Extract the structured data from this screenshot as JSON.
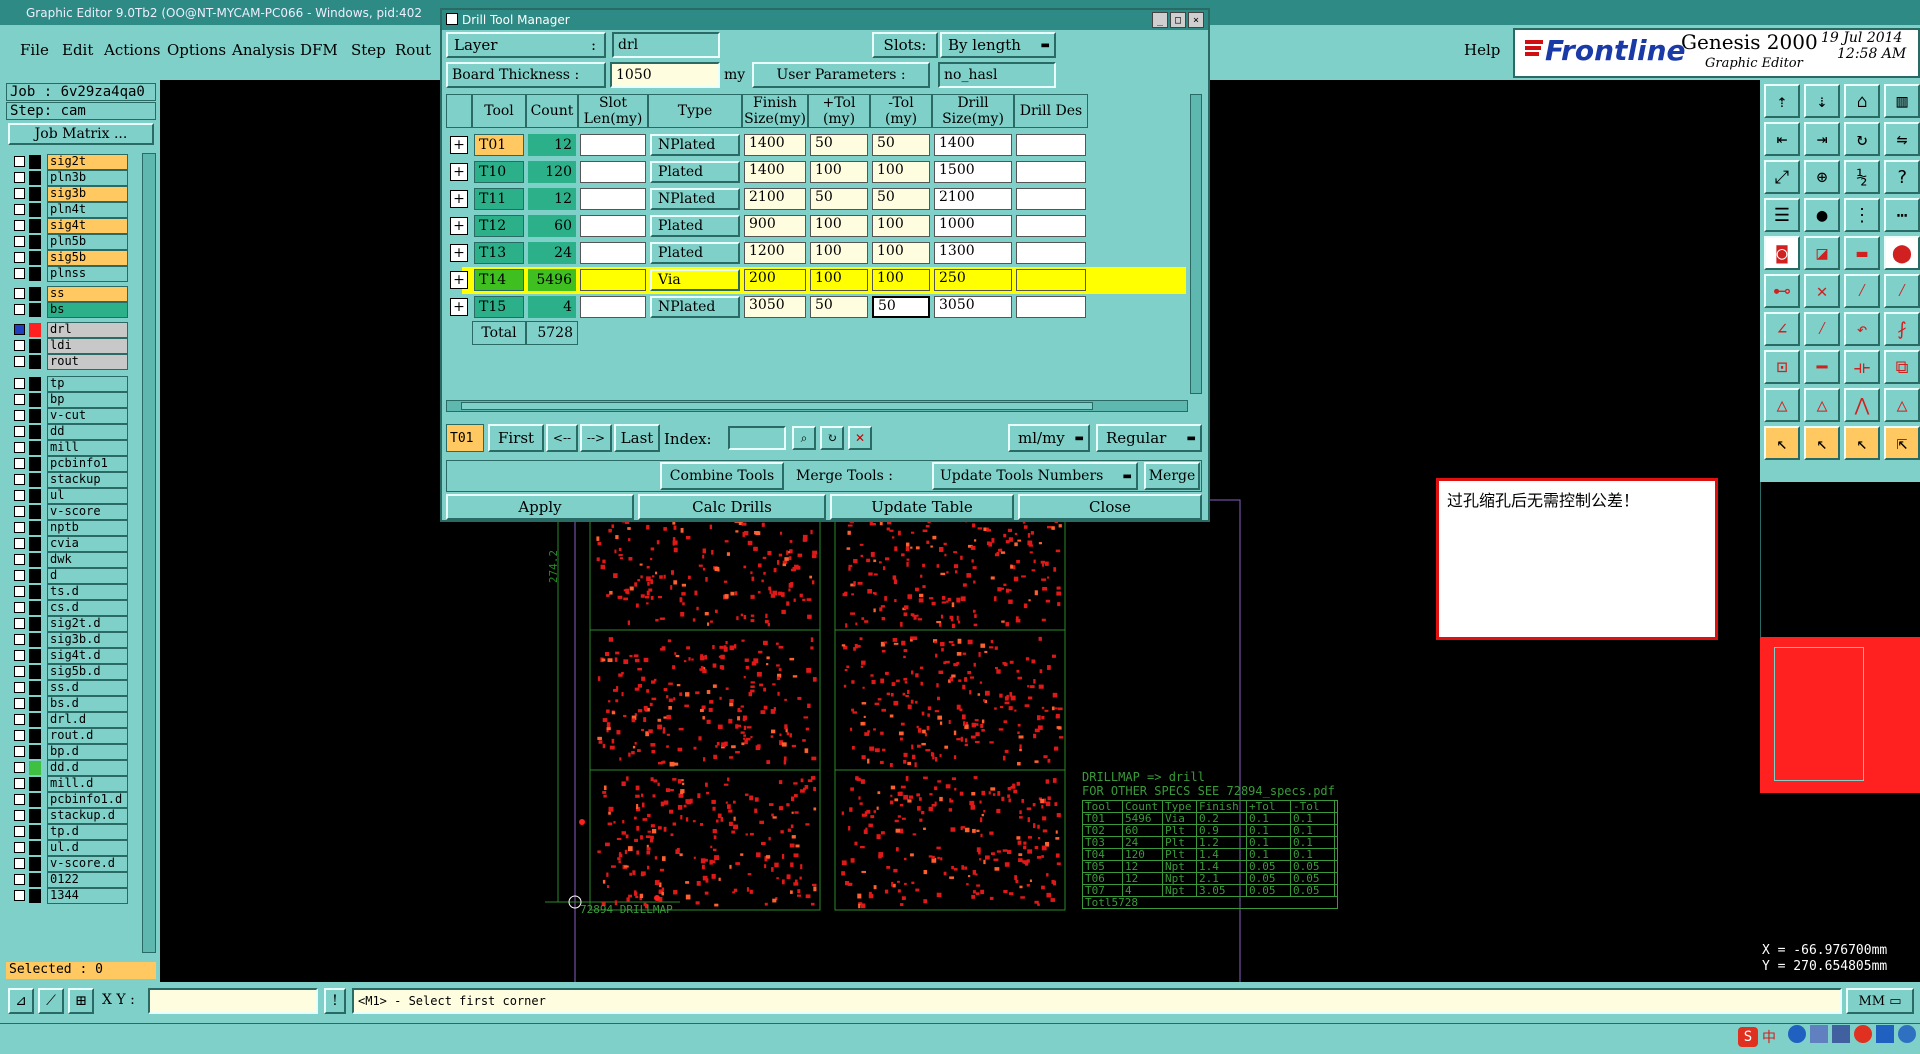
{
  "app": {
    "window_title": "Graphic Editor 9.0Tb2 (OO@NT-MYCAM-PC066 - Windows, pid:402",
    "menu": [
      "File",
      "Edit",
      "Actions",
      "Options",
      "Analysis",
      "DFM",
      "Step",
      "Rout"
    ],
    "help": "Help",
    "brand": "Frontline",
    "product": "Genesis 2000",
    "subtitle": "Graphic Editor",
    "date": "19 Jul 2014",
    "time": "12:58 AM"
  },
  "left": {
    "job": "Job : 6v29za4qa0",
    "step": "Step: cam",
    "job_matrix": "Job Matrix ...",
    "layers": [
      {
        "name": "sig2t",
        "color": "#ffc860"
      },
      {
        "name": "pln3b",
        "color": "#7ed0c8"
      },
      {
        "name": "sig3b",
        "color": "#ffc860"
      },
      {
        "name": "pln4t",
        "color": "#7ed0c8"
      },
      {
        "name": "sig4t",
        "color": "#ffc860"
      },
      {
        "name": "pln5b",
        "color": "#7ed0c8"
      },
      {
        "name": "sig5b",
        "color": "#ffc860"
      },
      {
        "name": "plnss",
        "color": "#7ed0c8"
      },
      {
        "name": "ss",
        "color": "#ffc860"
      },
      {
        "name": "bs",
        "color": "#2cb08a"
      },
      {
        "name": "drl",
        "color": "#c8c8c8"
      },
      {
        "name": "ldi",
        "color": "#c8c8c8"
      },
      {
        "name": "rout",
        "color": "#c8c8c8"
      },
      {
        "name": "tp",
        "color": "#7ed0c8"
      },
      {
        "name": "bp",
        "color": "#7ed0c8"
      },
      {
        "name": "v-cut",
        "color": "#7ed0c8"
      },
      {
        "name": "dd",
        "color": "#7ed0c8"
      },
      {
        "name": "mill",
        "color": "#7ed0c8"
      },
      {
        "name": "pcbinfo1",
        "color": "#7ed0c8"
      },
      {
        "name": "stackup",
        "color": "#7ed0c8"
      },
      {
        "name": "ul",
        "color": "#7ed0c8"
      },
      {
        "name": "v-score",
        "color": "#7ed0c8"
      },
      {
        "name": "nptb",
        "color": "#7ed0c8"
      },
      {
        "name": "cvia",
        "color": "#7ed0c8"
      },
      {
        "name": "dwk",
        "color": "#7ed0c8"
      },
      {
        "name": "d",
        "color": "#7ed0c8"
      },
      {
        "name": "ts.d",
        "color": "#7ed0c8"
      },
      {
        "name": "cs.d",
        "color": "#7ed0c8"
      },
      {
        "name": "sig2t.d",
        "color": "#7ed0c8"
      },
      {
        "name": "sig3b.d",
        "color": "#7ed0c8"
      },
      {
        "name": "sig4t.d",
        "color": "#7ed0c8"
      },
      {
        "name": "sig5b.d",
        "color": "#7ed0c8"
      },
      {
        "name": "ss.d",
        "color": "#7ed0c8"
      },
      {
        "name": "bs.d",
        "color": "#7ed0c8"
      },
      {
        "name": "drl.d",
        "color": "#7ed0c8"
      },
      {
        "name": "rout.d",
        "color": "#7ed0c8"
      },
      {
        "name": "bp.d",
        "color": "#7ed0c8"
      },
      {
        "name": "dd.d",
        "color": "#7ed0c8"
      },
      {
        "name": "mill.d",
        "color": "#7ed0c8"
      },
      {
        "name": "pcbinfo1.d",
        "color": "#7ed0c8"
      },
      {
        "name": "stackup.d",
        "color": "#7ed0c8"
      },
      {
        "name": "tp.d",
        "color": "#7ed0c8"
      },
      {
        "name": "ul.d",
        "color": "#7ed0c8"
      },
      {
        "name": "v-score.d",
        "color": "#7ed0c8"
      },
      {
        "name": "0122",
        "color": "#7ed0c8"
      },
      {
        "name": "1344",
        "color": "#7ed0c8"
      }
    ],
    "selected": "Selected : 0"
  },
  "dialog": {
    "title": "Drill Tool Manager",
    "layer_label": "Layer",
    "layer_value": "drl",
    "slots_label": "Slots:",
    "slots_value": "By length",
    "thickness_label": "Board Thickness :",
    "thickness_value": "1050",
    "thickness_unit": "my",
    "user_params_label": "User Parameters :",
    "user_params_value": "no_hasl",
    "columns": [
      "Tool",
      "Count",
      "Slot Len(my)",
      "Type",
      "Finish Size(my)",
      "+Tol (my)",
      "-Tol (my)",
      "Drill Size(my)",
      "Drill Des"
    ],
    "rows": [
      {
        "tool": "T01",
        "count": "12",
        "type": "NPlated",
        "finish": "1400",
        "ptol": "50",
        "mtol": "50",
        "drill": "1400"
      },
      {
        "tool": "T10",
        "count": "120",
        "type": "Plated",
        "finish": "1400",
        "ptol": "100",
        "mtol": "100",
        "drill": "1500"
      },
      {
        "tool": "T11",
        "count": "12",
        "type": "NPlated",
        "finish": "2100",
        "ptol": "50",
        "mtol": "50",
        "drill": "2100"
      },
      {
        "tool": "T12",
        "count": "60",
        "type": "Plated",
        "finish": "900",
        "ptol": "100",
        "mtol": "100",
        "drill": "1000"
      },
      {
        "tool": "T13",
        "count": "24",
        "type": "Plated",
        "finish": "1200",
        "ptol": "100",
        "mtol": "100",
        "drill": "1300"
      },
      {
        "tool": "T14",
        "count": "5496",
        "type": "Via",
        "finish": "200",
        "ptol": "100",
        "mtol": "100",
        "drill": "250"
      },
      {
        "tool": "T15",
        "count": "4",
        "type": "NPlated",
        "finish": "3050",
        "ptol": "50",
        "mtol": "50",
        "drill": "3050"
      }
    ],
    "total_label": "Total",
    "total_value": "5728",
    "nav": {
      "current": "T01",
      "first": "First",
      "prev": "<--",
      "next": "-->",
      "last": "Last",
      "index": "Index:",
      "units": "ml/my",
      "mode": "Regular"
    },
    "combine": "Combine Tools",
    "merge_tools": "Merge Tools :",
    "update_numbers": "Update Tools Numbers",
    "merge": "Merge",
    "apply": "Apply",
    "calc": "Calc Drills",
    "update_table": "Update Table",
    "close": "Close"
  },
  "note": "过孔缩孔后无需控制公差！",
  "drillmap": {
    "title": "DRILLMAP => drill",
    "specs": "FOR OTHER SPECS SEE 72894_specs.pdf",
    "header": [
      "Tool",
      "Count",
      "Type",
      "Finish",
      "+Tol",
      "-Tol"
    ],
    "rows": [
      [
        "T01",
        "5496",
        "Via",
        "0.2",
        "0.1",
        "0.1"
      ],
      [
        "T02",
        "60",
        "Plt",
        "0.9",
        "0.1",
        "0.1"
      ],
      [
        "T03",
        "24",
        "Plt",
        "1.2",
        "0.1",
        "0.1"
      ],
      [
        "T04",
        "120",
        "Plt",
        "1.4",
        "0.1",
        "0.1"
      ],
      [
        "T05",
        "12",
        "Npt",
        "1.4",
        "0.05",
        "0.05"
      ],
      [
        "T06",
        "12",
        "Npt",
        "2.1",
        "0.05",
        "0.05"
      ],
      [
        "T07",
        "4",
        "Npt",
        "3.05",
        "0.05",
        "0.05"
      ]
    ],
    "total": "Totl5728",
    "caption": "72894  DRILLMAP",
    "dim": "274.2"
  },
  "coords": {
    "x": "X = -66.976700mm",
    "y": "Y = 270.654805mm"
  },
  "status": {
    "xy_label": "X Y :",
    "message": "<M1> - Select first corner",
    "units": "MM"
  },
  "taskbar": {
    "ime": "中"
  }
}
